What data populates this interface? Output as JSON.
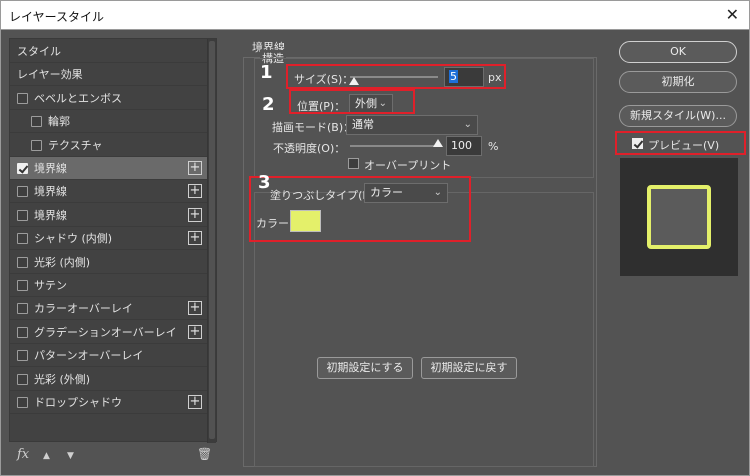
{
  "window": {
    "title": "レイヤースタイル",
    "close_glyph": "✕"
  },
  "left_panel": {
    "items": [
      {
        "label": "スタイル",
        "checkbox": false,
        "checked": false,
        "plus": false,
        "indent": 0,
        "selected": false
      },
      {
        "label": "レイヤー効果",
        "checkbox": false,
        "checked": false,
        "plus": false,
        "indent": 0,
        "selected": false
      },
      {
        "label": "ベベルとエンボス",
        "checkbox": true,
        "checked": false,
        "plus": false,
        "indent": 0,
        "selected": false
      },
      {
        "label": "輪郭",
        "checkbox": true,
        "checked": false,
        "plus": false,
        "indent": 1,
        "selected": false
      },
      {
        "label": "テクスチャ",
        "checkbox": true,
        "checked": false,
        "plus": false,
        "indent": 1,
        "selected": false
      },
      {
        "label": "境界線",
        "checkbox": true,
        "checked": true,
        "plus": true,
        "indent": 0,
        "selected": true
      },
      {
        "label": "境界線",
        "checkbox": true,
        "checked": false,
        "plus": true,
        "indent": 0,
        "selected": false
      },
      {
        "label": "境界線",
        "checkbox": true,
        "checked": false,
        "plus": true,
        "indent": 0,
        "selected": false
      },
      {
        "label": "シャドウ (内側)",
        "checkbox": true,
        "checked": false,
        "plus": true,
        "indent": 0,
        "selected": false
      },
      {
        "label": "光彩 (内側)",
        "checkbox": true,
        "checked": false,
        "plus": false,
        "indent": 0,
        "selected": false
      },
      {
        "label": "サテン",
        "checkbox": true,
        "checked": false,
        "plus": false,
        "indent": 0,
        "selected": false
      },
      {
        "label": "カラーオーバーレイ",
        "checkbox": true,
        "checked": false,
        "plus": true,
        "indent": 0,
        "selected": false
      },
      {
        "label": "グラデーションオーバーレイ",
        "checkbox": true,
        "checked": false,
        "plus": true,
        "indent": 0,
        "selected": false
      },
      {
        "label": "パターンオーバーレイ",
        "checkbox": true,
        "checked": false,
        "plus": false,
        "indent": 0,
        "selected": false
      },
      {
        "label": "光彩 (外側)",
        "checkbox": true,
        "checked": false,
        "plus": false,
        "indent": 0,
        "selected": false
      },
      {
        "label": "ドロップシャドウ",
        "checkbox": true,
        "checked": false,
        "plus": true,
        "indent": 0,
        "selected": false
      }
    ],
    "plus_glyph": "+",
    "tools": {
      "fx": "fx",
      "up": "▲",
      "down": "▼",
      "trash": "🗑"
    }
  },
  "stroke": {
    "group_title": "境界線",
    "structure_title": "構造",
    "size_label": "サイズ(S)：",
    "size_value": "5",
    "size_unit": "px",
    "size_slider_pct": 5,
    "position_label": "位置(P)：",
    "position_value": "外側",
    "blend_label": "描画モード(B)：",
    "blend_value": "通常",
    "opacity_label": "不透明度(O)：",
    "opacity_value": "100",
    "opacity_unit": "%",
    "opacity_slider_pct": 100,
    "overprint_label": "オーバープリント",
    "fill_type_label": "塗りつぶしタイプ(F)：",
    "fill_type_value": "カラー",
    "color_label": "カラー：",
    "color_hex": "#e4f06a",
    "reset_default_button": "初期設定にする",
    "restore_default_button": "初期設定に戻す"
  },
  "markers": [
    "1",
    "2",
    "3"
  ],
  "actions": {
    "ok": "OK",
    "reset": "初期化",
    "new_style": "新規スタイル(W)...",
    "preview_label": "プレビュー(V)",
    "preview_checked": true
  },
  "colors": {
    "highlight": "#e0202a",
    "stroke_color": "#e4f06a"
  }
}
